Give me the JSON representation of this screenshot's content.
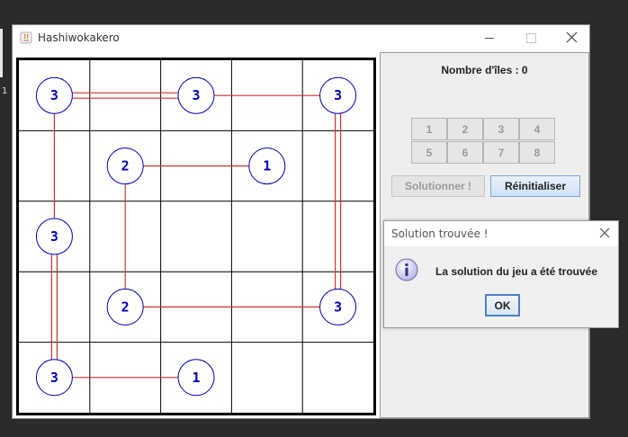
{
  "window": {
    "title": "Hashiwokakero"
  },
  "side_marker": "1",
  "board": {
    "rows": 5,
    "cols": 5,
    "line_color": "#cc3333",
    "island_color": "#0000bb",
    "islands": [
      {
        "row": 0,
        "col": 0,
        "value": "3"
      },
      {
        "row": 0,
        "col": 2,
        "value": "3"
      },
      {
        "row": 0,
        "col": 4,
        "value": "3"
      },
      {
        "row": 1,
        "col": 1,
        "value": "2"
      },
      {
        "row": 1,
        "col": 3,
        "value": "1"
      },
      {
        "row": 2,
        "col": 0,
        "value": "3"
      },
      {
        "row": 3,
        "col": 1,
        "value": "2"
      },
      {
        "row": 3,
        "col": 4,
        "value": "3"
      },
      {
        "row": 4,
        "col": 0,
        "value": "3"
      },
      {
        "row": 4,
        "col": 2,
        "value": "1"
      }
    ],
    "bridges": [
      {
        "from": [
          0,
          0
        ],
        "to": [
          0,
          2
        ],
        "count": 2
      },
      {
        "from": [
          0,
          2
        ],
        "to": [
          0,
          4
        ],
        "count": 1
      },
      {
        "from": [
          0,
          4
        ],
        "to": [
          3,
          4
        ],
        "count": 2
      },
      {
        "from": [
          1,
          1
        ],
        "to": [
          1,
          3
        ],
        "count": 1
      },
      {
        "from": [
          1,
          1
        ],
        "to": [
          3,
          1
        ],
        "count": 1
      },
      {
        "from": [
          3,
          1
        ],
        "to": [
          3,
          4
        ],
        "count": 1
      },
      {
        "from": [
          0,
          0
        ],
        "to": [
          2,
          0
        ],
        "count": 1
      },
      {
        "from": [
          2,
          0
        ],
        "to": [
          4,
          0
        ],
        "count": 2
      },
      {
        "from": [
          4,
          0
        ],
        "to": [
          4,
          2
        ],
        "count": 1
      }
    ]
  },
  "panel": {
    "island_count_label": "Nombre d'îles : 0",
    "number_buttons": [
      "1",
      "2",
      "3",
      "4",
      "5",
      "6",
      "7",
      "8"
    ],
    "solve_label": "Solutionner !",
    "reset_label": "Réinitialiser"
  },
  "dialog": {
    "title": "Solution trouvée !",
    "message": "La solution du jeu a été trouvée",
    "ok_label": "OK"
  }
}
